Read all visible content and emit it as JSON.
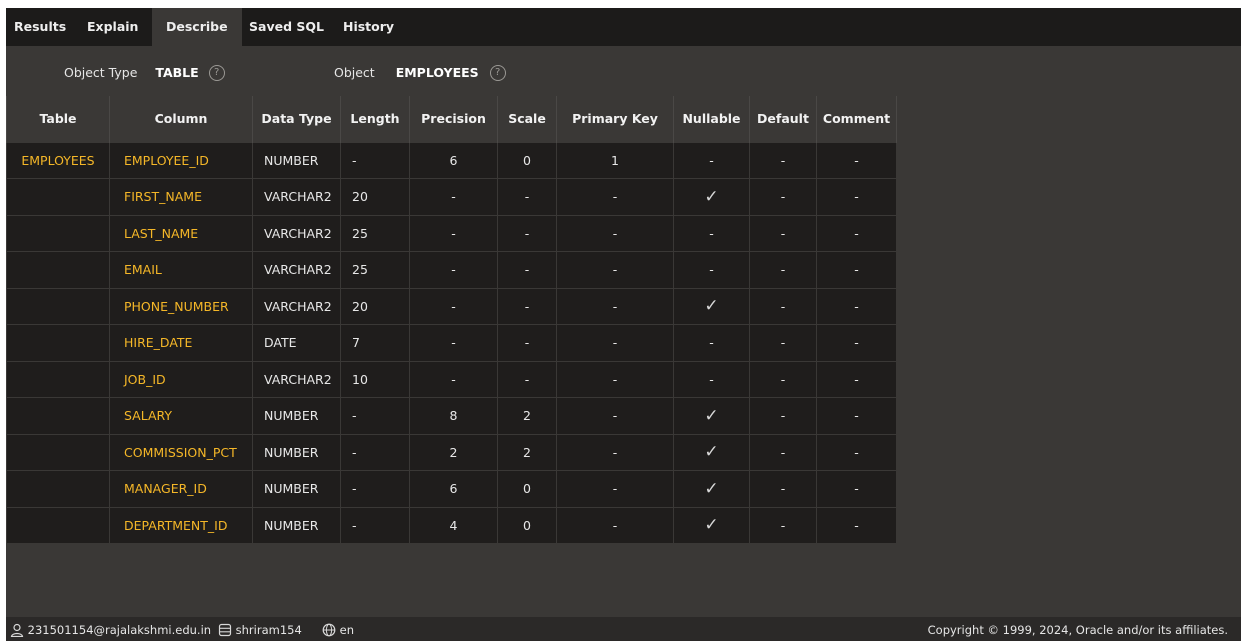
{
  "tabs": [
    {
      "label": "Results",
      "active": false
    },
    {
      "label": "Explain",
      "active": false
    },
    {
      "label": "Describe",
      "active": true
    },
    {
      "label": "Saved SQL",
      "active": false
    },
    {
      "label": "History",
      "active": false
    }
  ],
  "object_bar": {
    "object_type_label": "Object Type",
    "object_type_value": "TABLE",
    "object_label": "Object",
    "object_value": "EMPLOYEES",
    "help_glyph": "?"
  },
  "table": {
    "headers": [
      "Table",
      "Column",
      "Data Type",
      "Length",
      "Precision",
      "Scale",
      "Primary Key",
      "Nullable",
      "Default",
      "Comment"
    ],
    "rows": [
      {
        "table": "EMPLOYEES",
        "column": "EMPLOYEE_ID",
        "data_type": "NUMBER",
        "length": "-",
        "precision": "6",
        "scale": "0",
        "primary_key": "1",
        "nullable": "-",
        "default": "-",
        "comment": "-"
      },
      {
        "table": "",
        "column": "FIRST_NAME",
        "data_type": "VARCHAR2",
        "length": "20",
        "precision": "-",
        "scale": "-",
        "primary_key": "-",
        "nullable": "✓",
        "default": "-",
        "comment": "-"
      },
      {
        "table": "",
        "column": "LAST_NAME",
        "data_type": "VARCHAR2",
        "length": "25",
        "precision": "-",
        "scale": "-",
        "primary_key": "-",
        "nullable": "-",
        "default": "-",
        "comment": "-"
      },
      {
        "table": "",
        "column": "EMAIL",
        "data_type": "VARCHAR2",
        "length": "25",
        "precision": "-",
        "scale": "-",
        "primary_key": "-",
        "nullable": "-",
        "default": "-",
        "comment": "-"
      },
      {
        "table": "",
        "column": "PHONE_NUMBER",
        "data_type": "VARCHAR2",
        "length": "20",
        "precision": "-",
        "scale": "-",
        "primary_key": "-",
        "nullable": "✓",
        "default": "-",
        "comment": "-"
      },
      {
        "table": "",
        "column": "HIRE_DATE",
        "data_type": "DATE",
        "length": "7",
        "precision": "-",
        "scale": "-",
        "primary_key": "-",
        "nullable": "-",
        "default": "-",
        "comment": "-"
      },
      {
        "table": "",
        "column": "JOB_ID",
        "data_type": "VARCHAR2",
        "length": "10",
        "precision": "-",
        "scale": "-",
        "primary_key": "-",
        "nullable": "-",
        "default": "-",
        "comment": "-"
      },
      {
        "table": "",
        "column": "SALARY",
        "data_type": "NUMBER",
        "length": "-",
        "precision": "8",
        "scale": "2",
        "primary_key": "-",
        "nullable": "✓",
        "default": "-",
        "comment": "-"
      },
      {
        "table": "",
        "column": "COMMISSION_PCT",
        "data_type": "NUMBER",
        "length": "-",
        "precision": "2",
        "scale": "2",
        "primary_key": "-",
        "nullable": "✓",
        "default": "-",
        "comment": "-"
      },
      {
        "table": "",
        "column": "MANAGER_ID",
        "data_type": "NUMBER",
        "length": "-",
        "precision": "6",
        "scale": "0",
        "primary_key": "-",
        "nullable": "✓",
        "default": "-",
        "comment": "-"
      },
      {
        "table": "",
        "column": "DEPARTMENT_ID",
        "data_type": "NUMBER",
        "length": "-",
        "precision": "4",
        "scale": "0",
        "primary_key": "-",
        "nullable": "✓",
        "default": "-",
        "comment": "-"
      }
    ]
  },
  "status_bar": {
    "user": "231501154@rajalakshmi.edu.in",
    "schema": "shriram154",
    "language": "en",
    "copyright": "Copyright © 1999, 2024, Oracle and/or its affiliates.",
    "icons": {
      "user": "user-icon",
      "schema": "database-icon",
      "language": "globe-icon"
    }
  },
  "colors": {
    "accent_yellow": "#f5b728",
    "tabbar_bg": "#1c1b1a",
    "panel_bg": "#3a3836",
    "cell_bg": "#1f1d1c"
  }
}
